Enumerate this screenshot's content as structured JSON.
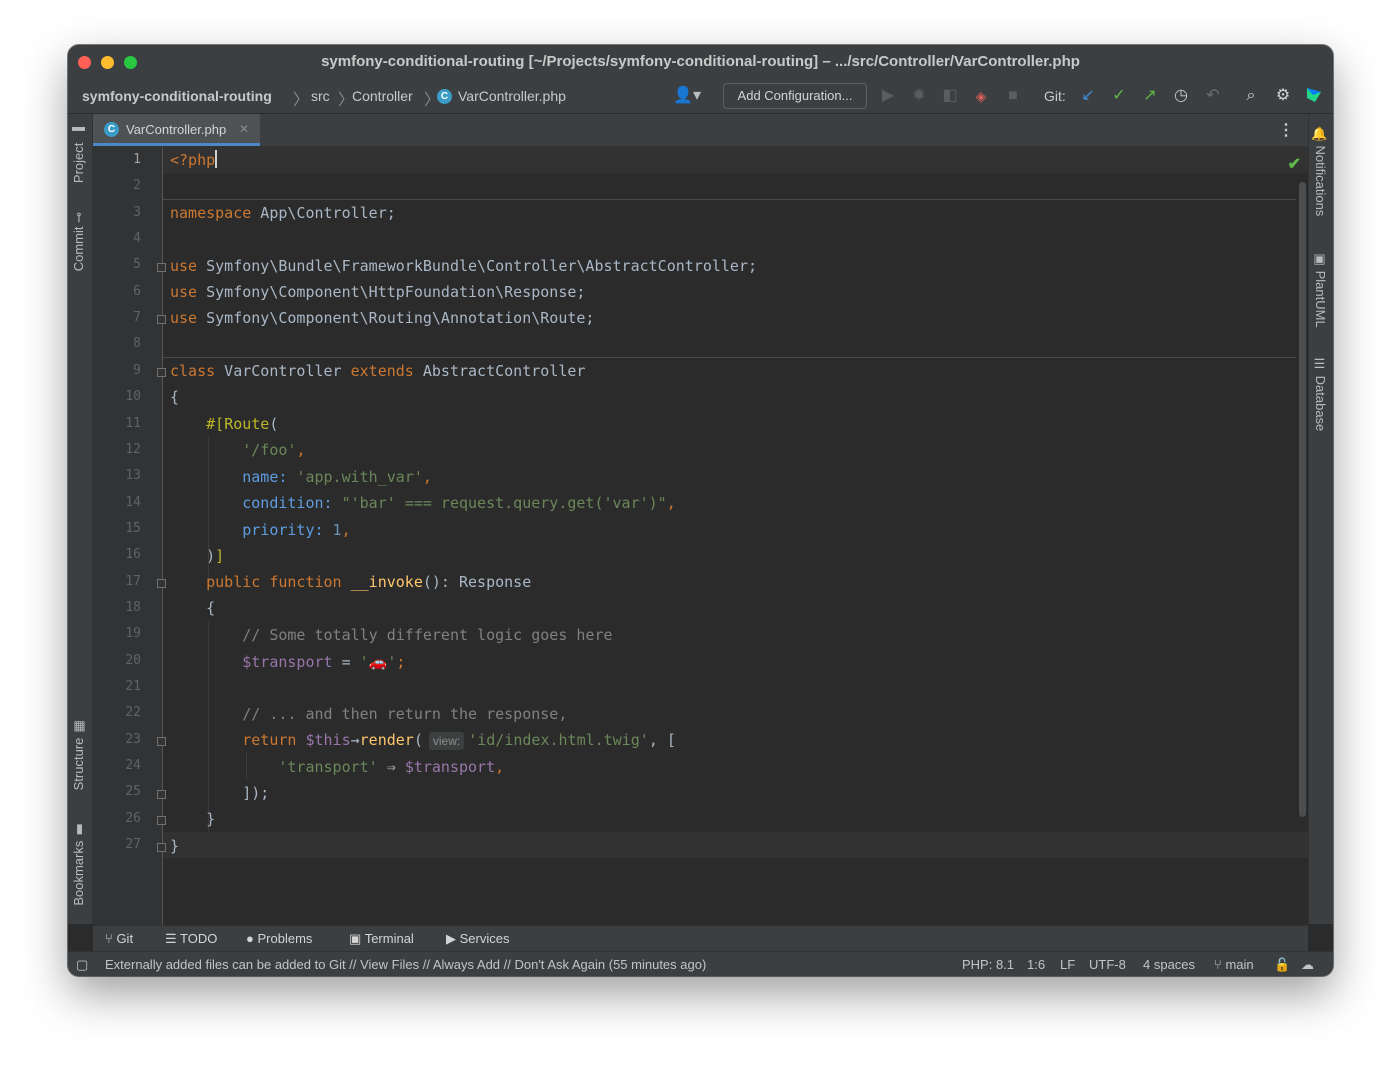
{
  "window": {
    "title": "symfony-conditional-routing [~/Projects/symfony-conditional-routing] – .../src/Controller/VarController.php"
  },
  "breadcrumbs": [
    "symfony-conditional-routing",
    "src",
    "Controller",
    "VarController.php"
  ],
  "toolbar": {
    "add_configuration": "Add Configuration...",
    "git_label": "Git:",
    "icons": [
      "user-icon",
      "run-icon",
      "debug-icon",
      "coverage-icon",
      "profile-icon",
      "stop-icon",
      "git-update-icon",
      "git-commit-icon",
      "git-push-icon",
      "history-icon",
      "rollback-icon",
      "search-icon",
      "settings-icon",
      "jetbrains-logo"
    ]
  },
  "left_tool_tabs": [
    "Project",
    "Commit",
    "Structure",
    "Bookmarks"
  ],
  "right_tool_tabs": [
    "Notifications",
    "PlantUML",
    "Database"
  ],
  "editor_tab": {
    "label": "VarController.php",
    "icon_letter": "C",
    "close": "✕"
  },
  "editor": {
    "line_numbers": [
      "1",
      "2",
      "3",
      "4",
      "5",
      "6",
      "7",
      "8",
      "9",
      "10",
      "11",
      "12",
      "13",
      "14",
      "15",
      "16",
      "17",
      "18",
      "19",
      "20",
      "21",
      "22",
      "23",
      "24",
      "25",
      "26",
      "27"
    ],
    "code": {
      "l1": "<?php",
      "l3a": "namespace",
      "l3b": " App\\Controller;",
      "l5a": "use",
      "l5b": " Symfony\\Bundle\\FrameworkBundle\\Controller\\AbstractController;",
      "l6a": "use",
      "l6b": " Symfony\\Component\\HttpFoundation\\Response;",
      "l7a": "use",
      "l7b": " Symfony\\Component\\Routing\\Annotation\\Route;",
      "l9a": "class",
      "l9b": " VarController ",
      "l9c": "extends",
      "l9d": " AbstractController",
      "l10": "{",
      "l11a": "    #[",
      "l11b": "Route",
      "l11c": "(",
      "l12a": "        ",
      "l12b": "'/foo'",
      "l12c": ",",
      "l13a": "        ",
      "l13b": "name:",
      "l13c": " 'app.with_var'",
      "l13d": ",",
      "l14a": "        ",
      "l14b": "condition:",
      "l14c": " \"'bar' ",
      "l14d": "===",
      "l14e": " request.query.get('var')\"",
      "l14f": ",",
      "l15a": "        ",
      "l15b": "priority:",
      "l15c": " 1",
      "l15d": ",",
      "l16a": "    )",
      "l16b": "]",
      "l17a": "    ",
      "l17b": "public function",
      "l17c": " __invoke",
      "l17d": "(): Response",
      "l18": "    {",
      "l19": "        // Some totally different logic goes here",
      "l20a": "        ",
      "l20b": "$transport",
      "l20c": " = ",
      "l20d": "'🚗'",
      "l20e": ";",
      "l22": "        // ... and then return the response,",
      "l23a": "        ",
      "l23b": "return",
      "l23c": " $this",
      "l23d": "→",
      "l23e": "render",
      "l23f": "(",
      "l23g": "view:",
      "l23h": "'id/index.html.twig'",
      "l23i": ", [",
      "l24a": "            ",
      "l24b": "'transport'",
      "l24c": " ⇒ ",
      "l24d": "$transport",
      "l24e": ",",
      "l25a": "        ]);",
      "l26": "    }",
      "l27": "}"
    }
  },
  "tool_windows": [
    "Git",
    "TODO",
    "Problems",
    "Terminal",
    "Services"
  ],
  "status": {
    "message": "Externally added files can be added to Git // View Files // Always Add // Don't Ask Again (55 minutes ago)",
    "php": "PHP: 8.1",
    "position": "1:6",
    "line_sep": "LF",
    "encoding": "UTF-8",
    "indent": "4 spaces",
    "branch": "main"
  },
  "colors": {
    "keyword": "#cc7832",
    "string": "#6a8759",
    "comment": "#808080",
    "variable": "#9876aa",
    "function": "#ffc66d",
    "attribute": "#bbb529",
    "number": "#6897bb",
    "editor_bg": "#2b2b2b",
    "panel_bg": "#3c3f41",
    "accent": "#4a88c7"
  }
}
